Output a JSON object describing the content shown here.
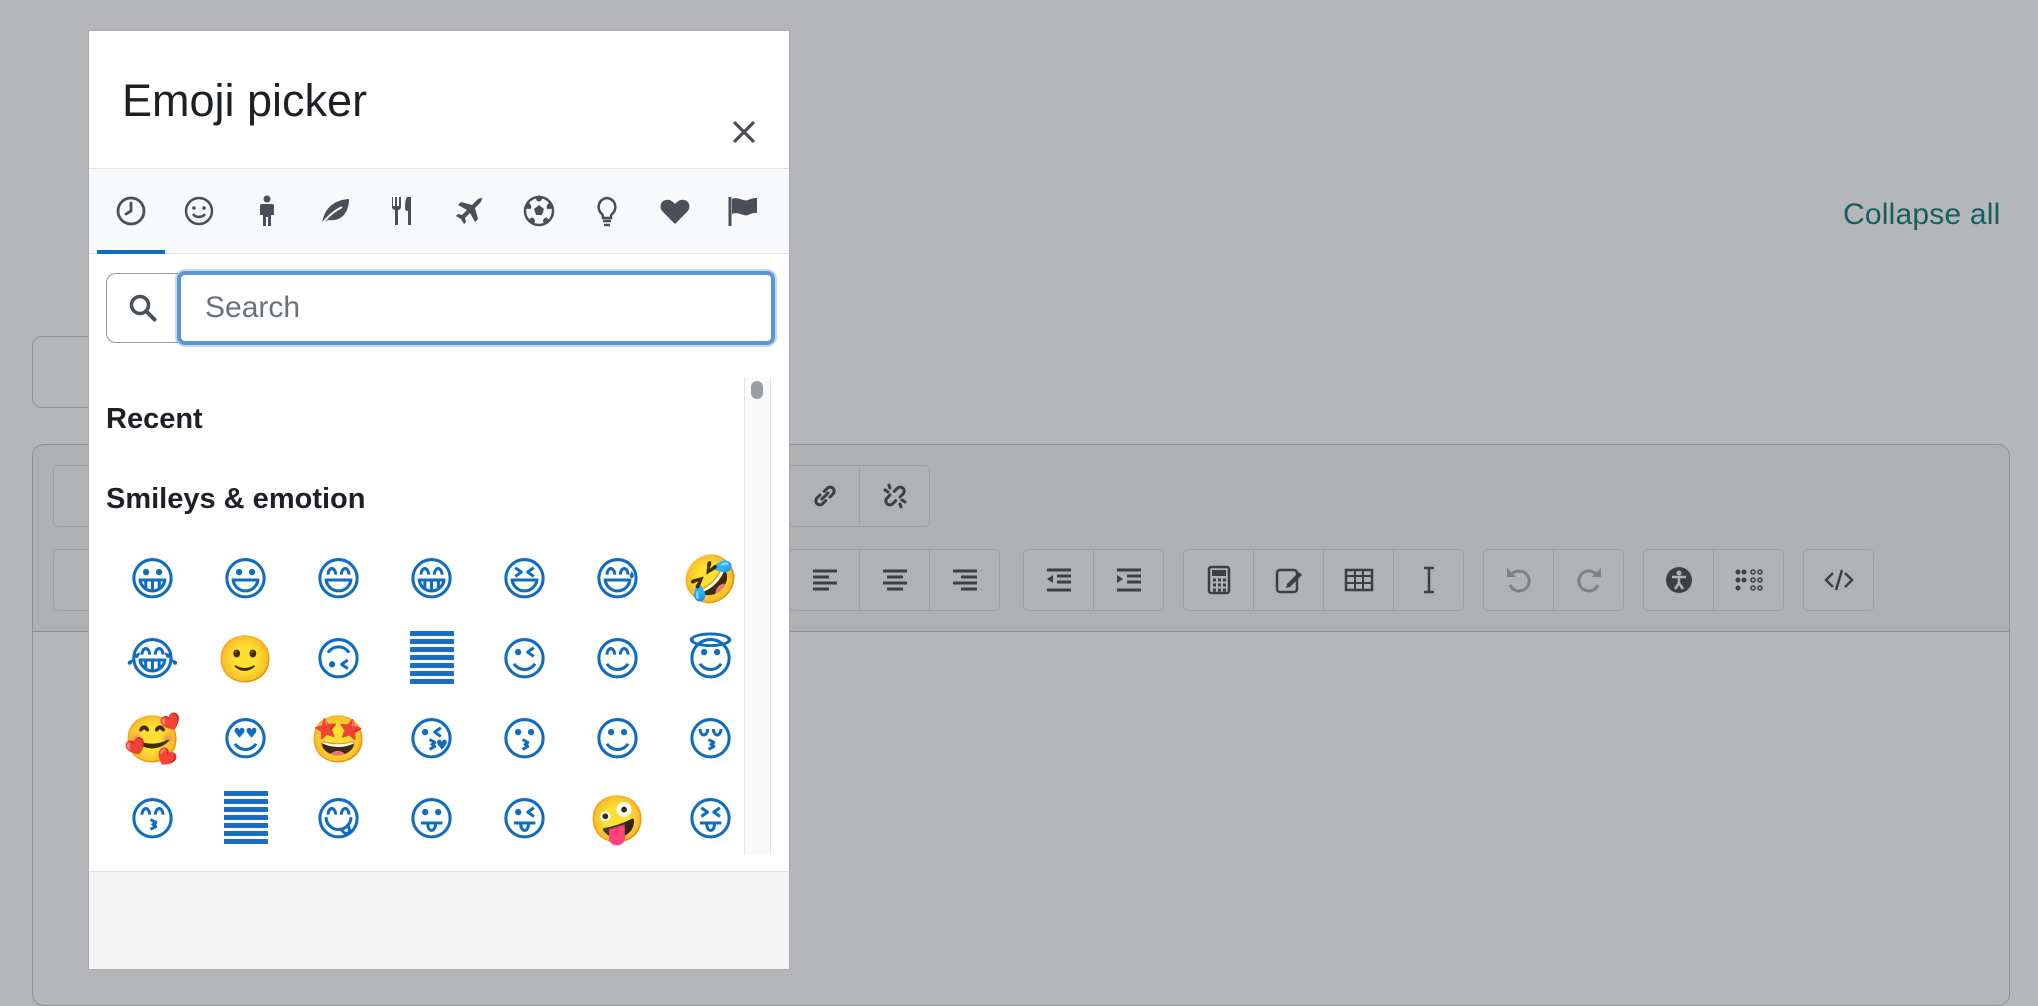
{
  "background": {
    "collapse_all": "Collapse all"
  },
  "picker": {
    "title": "Emoji picker",
    "close_label": "×",
    "tabs": [
      {
        "icon": "clock-icon",
        "label": "Recent"
      },
      {
        "icon": "smile-icon",
        "label": "Smileys & emotion"
      },
      {
        "icon": "person-icon",
        "label": "People & body"
      },
      {
        "icon": "leaf-icon",
        "label": "Animals & nature"
      },
      {
        "icon": "cutlery-icon",
        "label": "Food & drink"
      },
      {
        "icon": "plane-icon",
        "label": "Travel & places"
      },
      {
        "icon": "soccer-ball-icon",
        "label": "Activities"
      },
      {
        "icon": "lightbulb-icon",
        "label": "Objects"
      },
      {
        "icon": "heart-icon",
        "label": "Symbols"
      },
      {
        "icon": "flag-icon",
        "label": "Flags"
      }
    ],
    "active_tab": 0,
    "search": {
      "placeholder": "Search",
      "value": ""
    },
    "sections": {
      "recent": "Recent",
      "smileys": "Smileys & emotion"
    },
    "emojis": [
      "😀",
      "😃",
      "😄",
      "😁",
      "😆",
      "😅",
      "🤣",
      "😂",
      "🙂",
      "🙃",
      "",
      "😉",
      "😊",
      "😇",
      "🥰",
      "😍",
      "🤩",
      "😘",
      "😗",
      "☺",
      "😚",
      "😙",
      "",
      "😋",
      "😛",
      "😜",
      "🤪",
      "😝"
    ]
  },
  "colors": {
    "accent": "#0f6cbf",
    "focus_ring": "#5a95d4",
    "overlay": "#b5b6b9",
    "link": "#155e60"
  }
}
